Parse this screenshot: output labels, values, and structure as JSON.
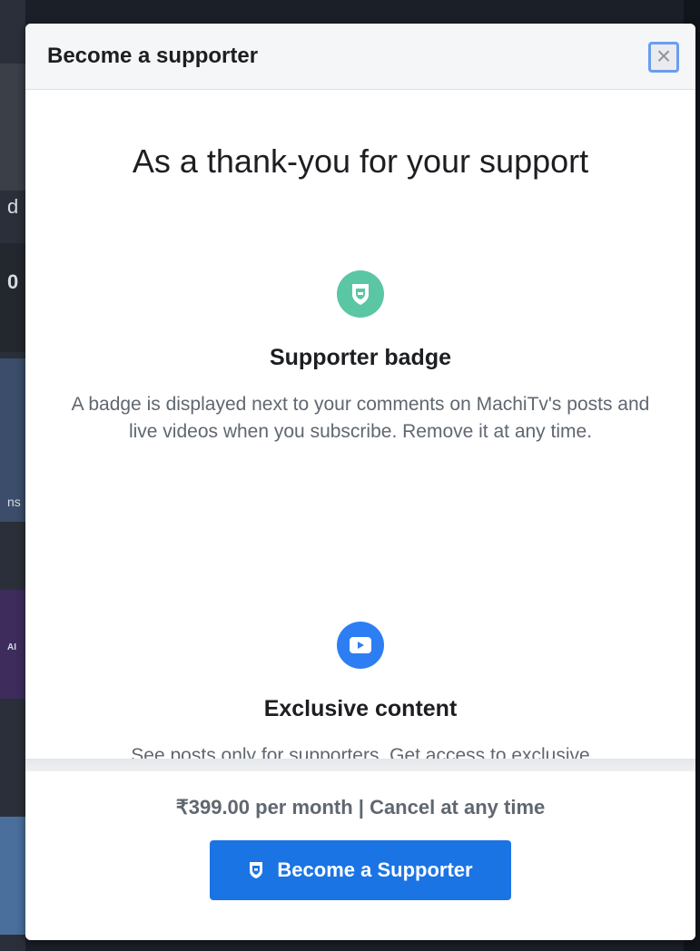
{
  "modal": {
    "title": "Become a supporter",
    "close_icon": "close-icon",
    "headline": "As a thank-you for your support",
    "features": [
      {
        "icon": "badge-shield-icon",
        "icon_color": "#5bc6a3",
        "title": "Supporter badge",
        "description": "A badge is displayed next to your comments on MachiTv's posts and live videos when you subscribe. Remove it at any time."
      },
      {
        "icon": "video-play-icon",
        "icon_color": "#2d7ef3",
        "title": "Exclusive content",
        "description": "See posts only for supporters. Get access to exclusive"
      }
    ],
    "price_text": "₹399.00 per month | Cancel at any time",
    "cta_label": "Become a Supporter",
    "cta_icon": "badge-shield-icon",
    "cta_color": "#1b74e4"
  },
  "background": {
    "partial_texts": [
      "d",
      "0",
      "ns",
      "AI"
    ]
  }
}
